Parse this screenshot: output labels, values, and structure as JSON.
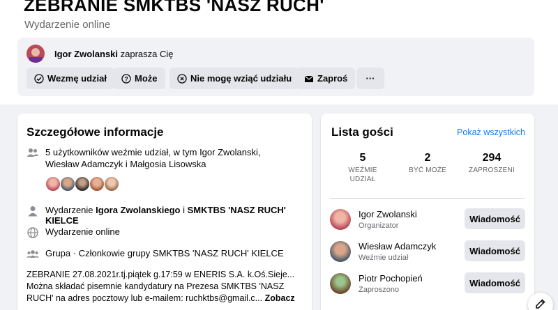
{
  "event": {
    "title": "ZEBRANIE SMKTBS 'NASZ RUCH'",
    "subtitle": "Wydarzenie online"
  },
  "host": {
    "name": "Igor Zwolanski",
    "invite_suffix": "zaprasza Cię"
  },
  "actions": {
    "going": "Wezmę udział",
    "maybe": "Może",
    "cant_go": "Nie mogę wziąć udziału",
    "invite": "Zaproś",
    "more": "···"
  },
  "details": {
    "heading": "Szczegółowe informacje",
    "attending": "5 użytkowników weźmie udział, w tym Igor Zwolanski, Wiesław Adamczyk i Małgosia Lisowska",
    "organizer_prefix": "Wydarzenie ",
    "organizer_name": "Igora Zwolanskiego",
    "organizer_join": " i ",
    "organizer_group": "SMKTBS 'NASZ RUCH' KIELCE",
    "online": "Wydarzenie online",
    "group_line": "Grupa · Członkowie grupy SMKTBS 'NASZ RUCH' KIELCE",
    "description": "ZEBRANIE 27.08.2021r.tj.piątek g.17:59 w ENERIS S.A. k.Oś.Sieje... Można składać pisemnie kandydatury na Prezesa SMKTBS 'NASZ RUCH' na adres pocztowy lub e-mailem: ruchktbs@gmail.c...",
    "see_more": "Zobacz"
  },
  "guests": {
    "heading": "Lista gości",
    "see_all": "Pokaż wszystkich",
    "stats": [
      {
        "value": "5",
        "label": "WEŹMIE UDZIAŁ"
      },
      {
        "value": "2",
        "label": "BYĆ MOŻE"
      },
      {
        "value": "294",
        "label": "ZAPROSZENI"
      }
    ],
    "list": [
      {
        "name": "Igor Zwolanski",
        "role": "Organizator",
        "button": "Wiadomość"
      },
      {
        "name": "Wiesław Adamczyk",
        "role": "Weźmie udział",
        "button": "Wiadomość"
      },
      {
        "name": "Piotr Pochopień",
        "role": "Zaproszono",
        "button": "Wiadomość"
      }
    ]
  },
  "icons": {
    "attending": "people-icon",
    "organizer": "person-icon",
    "online": "globe-icon",
    "group": "group-icon",
    "compose": "compose-icon"
  }
}
